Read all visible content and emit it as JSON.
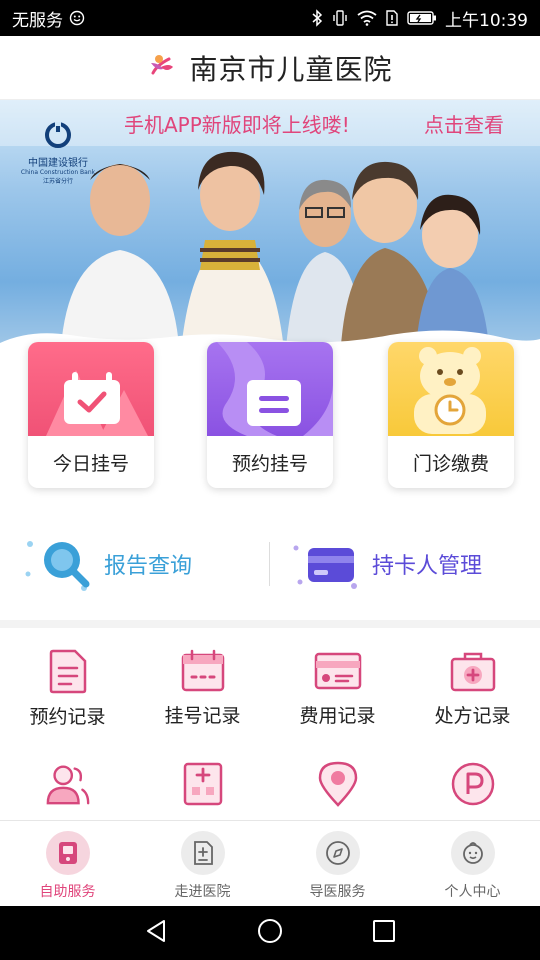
{
  "status_bar": {
    "carrier": "无服务",
    "time": "上午10:39"
  },
  "header": {
    "title": "南京市儿童医院"
  },
  "banner": {
    "notice": "手机APP新版即将上线喽!",
    "link": "点击查看",
    "bank_name": "中国建设银行",
    "bank_name_en": "China Construction Bank",
    "bank_branch": "江苏省分行"
  },
  "main_cards": [
    {
      "label": "今日挂号",
      "icon": "calendar-check-icon",
      "color": "#f0607f"
    },
    {
      "label": "预约挂号",
      "icon": "document-icon",
      "color": "#9b5de5"
    },
    {
      "label": "门诊缴费",
      "icon": "clock-bear-icon",
      "color": "#f8c93a"
    }
  ],
  "secondary": {
    "report": "报告查询",
    "card_holder": "持卡人管理"
  },
  "grid_items": [
    {
      "label": "预约记录",
      "icon": "document-icon"
    },
    {
      "label": "挂号记录",
      "icon": "calendar-icon"
    },
    {
      "label": "费用记录",
      "icon": "card-icon"
    },
    {
      "label": "处方记录",
      "icon": "medical-kit-icon"
    },
    {
      "label": "",
      "icon": "people-icon"
    },
    {
      "label": "",
      "icon": "hospital-icon"
    },
    {
      "label": "",
      "icon": "location-icon"
    },
    {
      "label": "",
      "icon": "parking-icon"
    }
  ],
  "tabs": [
    {
      "label": "自助服务",
      "icon": "self-service-icon",
      "active": true
    },
    {
      "label": "走进医院",
      "icon": "hospital-info-icon",
      "active": false
    },
    {
      "label": "导医服务",
      "icon": "compass-icon",
      "active": false
    },
    {
      "label": "个人中心",
      "icon": "child-face-icon",
      "active": false
    }
  ],
  "colors": {
    "accent": "#e0457b",
    "icon_pink": "#d6477c",
    "secondary_blue": "#3aa0d8",
    "secondary_purple": "#5b4bd8"
  }
}
